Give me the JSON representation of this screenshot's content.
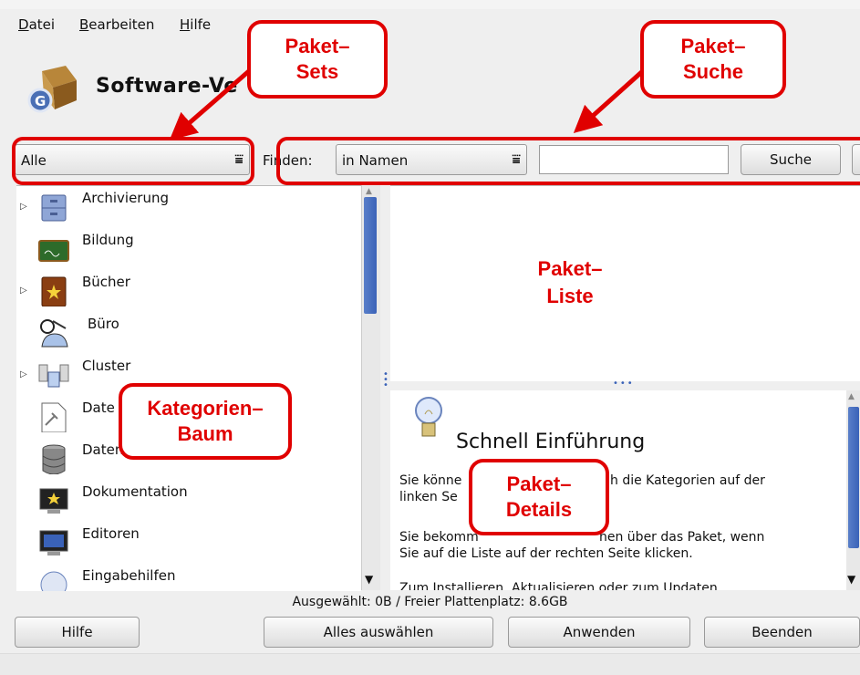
{
  "menu": [
    {
      "label": "Datei",
      "mnemonic": "D",
      "rest": "atei"
    },
    {
      "label": "Bearbeiten",
      "mnemonic": "B",
      "rest": "earbeiten"
    },
    {
      "label": "Hilfe",
      "mnemonic": "H",
      "rest": "ilfe"
    }
  ],
  "app": {
    "title": "Software-Ve"
  },
  "toolbar": {
    "set_value": "Alle",
    "finden_label": "Finden:",
    "search_scope": "in Namen",
    "search_value": "",
    "search_button": "Suche"
  },
  "tree": [
    {
      "label": "Archivierung",
      "expandable": true,
      "icon": "archive-icon"
    },
    {
      "label": "Bildung",
      "expandable": false,
      "icon": "chalkboard-icon"
    },
    {
      "label": "Bücher",
      "expandable": true,
      "icon": "book-icon"
    },
    {
      "label": "Büro",
      "expandable": false,
      "icon": "office-icon"
    },
    {
      "label": "Cluster",
      "expandable": true,
      "icon": "cluster-icon"
    },
    {
      "label": "Date",
      "expandable": false,
      "icon": "file-icon"
    },
    {
      "label": "Datenbanken",
      "expandable": false,
      "icon": "database-icon"
    },
    {
      "label": "Dokumentation",
      "expandable": false,
      "icon": "documentation-icon"
    },
    {
      "label": "Editoren",
      "expandable": false,
      "icon": "monitor-icon"
    },
    {
      "label": "Eingabehilfen",
      "expandable": false,
      "icon": "accessibility-icon"
    }
  ],
  "details": {
    "title": "Schnell Einführung",
    "para1_line1": "Sie könne",
    "para1_line1_end": "h die Kategorien auf der",
    "para1_line2": "linken Se",
    "para2_line1_start": "Sie bekomm",
    "para2_line1_end": "nen über das Paket, wenn",
    "para2_line2": "Sie auf die Liste auf der rechten Seite klicken.",
    "para3": "Zum Installieren, Aktualisieren oder zum Updaten"
  },
  "status": "Ausgewählt: 0B / Freier Plattenplatz: 8.6GB",
  "buttons": {
    "help": "Hilfe",
    "select_all": "Alles auswählen",
    "apply": "Anwenden",
    "quit": "Beenden"
  },
  "callouts": {
    "sets": [
      "Paket–",
      "Sets"
    ],
    "search": [
      "Paket–",
      "Suche"
    ],
    "list": [
      "Paket–",
      "Liste"
    ],
    "tree": [
      "Kategorien–",
      "Baum"
    ],
    "details": [
      "Paket–",
      "Details"
    ]
  },
  "colors": {
    "annotation": "#e00000",
    "scroll_thumb": "#3a62b8"
  }
}
